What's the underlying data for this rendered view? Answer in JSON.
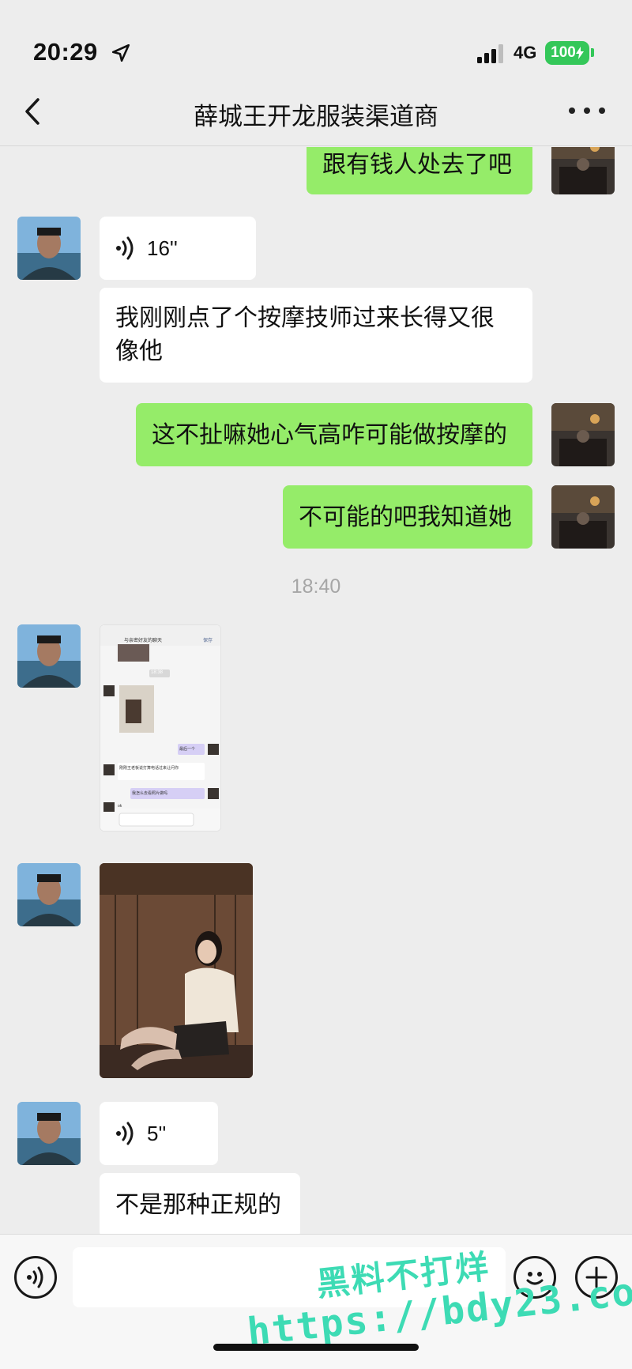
{
  "status_bar": {
    "time": "20:29",
    "network": "4G",
    "battery": "100"
  },
  "nav": {
    "title": "薛城王开龙服装渠道商"
  },
  "messages": {
    "m1": "跟有钱人处去了吧",
    "m2_voice": "16''",
    "m3": "我刚刚点了个按摩技师过来长得又很像他",
    "m4": "这不扯嘛她心气高咋可能做按摩的",
    "m5": "不可能的吧我知道她",
    "timestamp": "18:40",
    "m8_voice": "5''",
    "m9": "不是那种正规的"
  },
  "screenshot_preview": {
    "title": "与亲密好友的聊天",
    "action": "保存",
    "time_chip": "18:38",
    "chat1": "最后一个",
    "chat2": "刚刚王老板说打算电话过来让问你",
    "chat3": "我怎么去看照片做吗",
    "chat4": "ok"
  },
  "watermark": {
    "line1": "黑料不打烊",
    "line2": "https://bdy23.co"
  },
  "colors": {
    "background": "#ededed",
    "incoming_bubble": "#ffffff",
    "outgoing_bubble": "#95ec69",
    "battery": "#34c759",
    "watermark": "#3ddbb4"
  }
}
